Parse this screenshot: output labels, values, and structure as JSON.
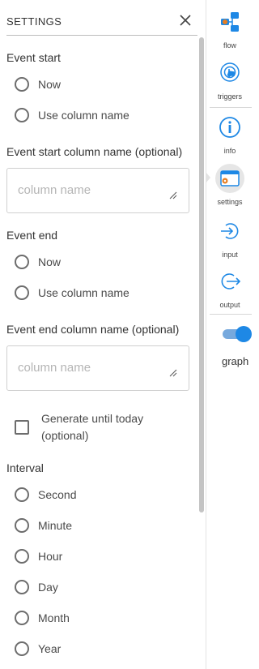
{
  "panel": {
    "title": "SETTINGS",
    "event_start": {
      "label": "Event start",
      "options": [
        "Now",
        "Use column name"
      ]
    },
    "event_start_column": {
      "label": "Event start column name (optional)",
      "placeholder": "column name",
      "value": ""
    },
    "event_end": {
      "label": "Event end",
      "options": [
        "Now",
        "Use column name"
      ]
    },
    "event_end_column": {
      "label": "Event end column name (optional)",
      "placeholder": "column name",
      "value": ""
    },
    "generate_until_today": {
      "label": "Generate until today (optional)",
      "checked": false
    },
    "interval": {
      "label": "Interval",
      "options": [
        "Second",
        "Minute",
        "Hour",
        "Day",
        "Month",
        "Year"
      ]
    }
  },
  "rail": {
    "items": [
      {
        "label": "flow",
        "icon": "flow-icon"
      },
      {
        "label": "triggers",
        "icon": "triggers-icon"
      },
      {
        "label": "info",
        "icon": "info-icon"
      },
      {
        "label": "settings",
        "icon": "settings-icon",
        "active": true
      },
      {
        "label": "input",
        "icon": "input-icon"
      },
      {
        "label": "output",
        "icon": "output-icon"
      }
    ],
    "graph_label": "graph",
    "graph_toggle_on": true
  },
  "colors": {
    "accent": "#1e88e5",
    "toggle_track": "#77a9dd",
    "icon_orange": "#e67e22"
  }
}
